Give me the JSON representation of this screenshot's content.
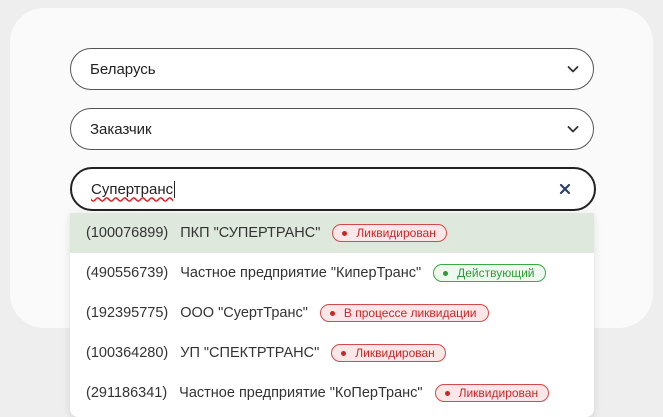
{
  "country_select": {
    "value": "Беларусь"
  },
  "role_select": {
    "value": "Заказчик"
  },
  "search": {
    "value": "Супертранс"
  },
  "status_colors": {
    "liquidated": "#c62828",
    "active": "#2e9b3a"
  },
  "results": [
    {
      "code": "(100076899)",
      "name": "ПКП \"СУПЕРТРАНС\"",
      "status": "Ликвидирован",
      "status_type": "red"
    },
    {
      "code": "(490556739)",
      "name": "Частное предприятие \"КиперТранс\"",
      "status": "Действующий",
      "status_type": "green"
    },
    {
      "code": "(192395775)",
      "name": "ООО \"СуертТранс\"",
      "status": "В процессе ликвидации",
      "status_type": "red"
    },
    {
      "code": "(100364280)",
      "name": "УП \"СПЕКТРТРАНС\"",
      "status": "Ликвидирован",
      "status_type": "red"
    },
    {
      "code": "(291186341)",
      "name": "Частное предприятие \"КоПерТранс\"",
      "status": "Ликвидирован",
      "status_type": "red"
    }
  ]
}
